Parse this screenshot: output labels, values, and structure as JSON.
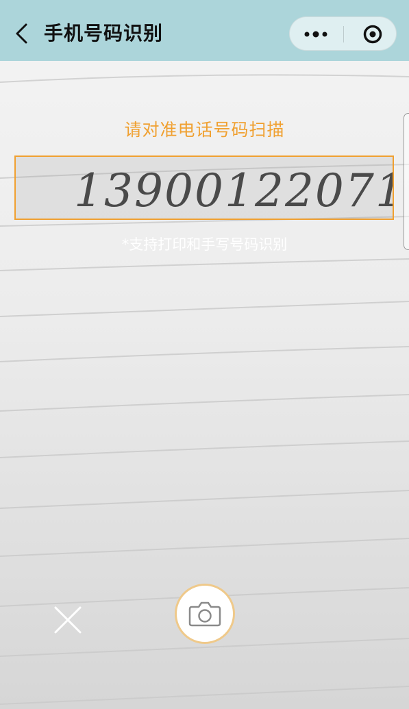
{
  "nav": {
    "title": "手机号码识别",
    "back_icon": "chevron-left-icon",
    "more_icon": "more-dots-icon",
    "close_icon": "target-close-icon"
  },
  "scanner": {
    "hint": "请对准电话号码扫描",
    "support_text": "*支持打印和手写号码识别",
    "handwritten_number": "13900122071",
    "frame_color": "#f0a030"
  },
  "controls": {
    "cancel_icon": "close-x-icon",
    "capture_icon": "camera-icon"
  },
  "colors": {
    "nav_bg": "#acd5da",
    "accent": "#f0a030"
  }
}
